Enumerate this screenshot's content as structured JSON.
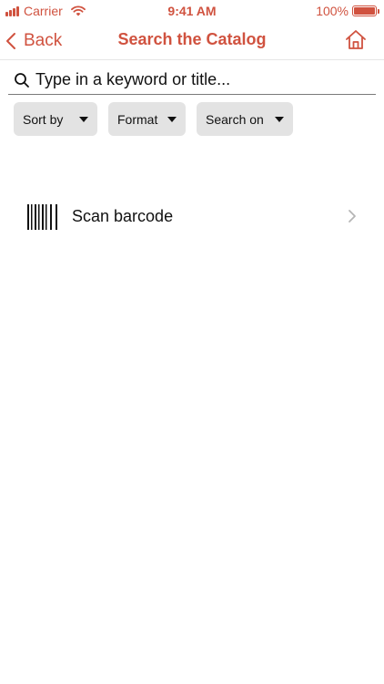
{
  "status_bar": {
    "carrier": "Carrier",
    "time": "9:41 AM",
    "battery_percent": "100%",
    "battery_level": 1.0,
    "color": "#d0523f"
  },
  "nav": {
    "back_label": "Back",
    "title": "Search the Catalog",
    "back_icon": "chevron-left-icon",
    "home_icon": "home-icon"
  },
  "search": {
    "placeholder": "Type in a keyword or title...",
    "value": "",
    "icon": "search-icon"
  },
  "filters": [
    {
      "label": "Sort by"
    },
    {
      "label": "Format"
    },
    {
      "label": "Search on"
    }
  ],
  "scan": {
    "label": "Scan barcode",
    "icon": "barcode-icon"
  },
  "colors": {
    "accent": "#d0523f",
    "chip_background": "#e3e3e3"
  }
}
